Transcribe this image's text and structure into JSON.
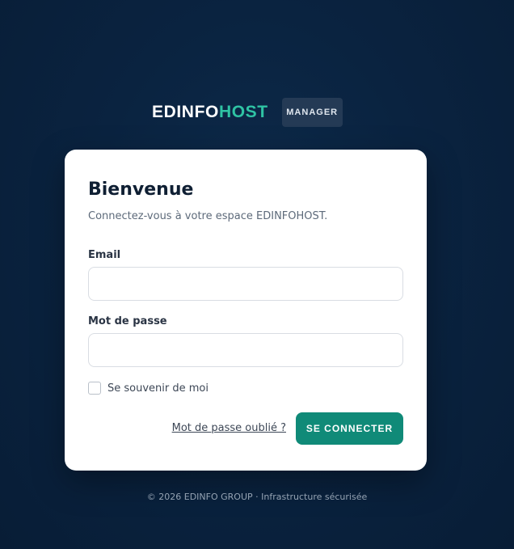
{
  "brand": {
    "name_part1": "EDINFO",
    "name_part2": "HOST",
    "badge": "MANAGER"
  },
  "login_card": {
    "title": "Bienvenue",
    "subtitle": "Connectez-vous à votre espace EDINFOHOST.",
    "email": {
      "label": "Email",
      "value": "",
      "placeholder": ""
    },
    "password": {
      "label": "Mot de passe",
      "value": "",
      "placeholder": ""
    },
    "remember": {
      "label": "Se souvenir de moi",
      "checked": false
    },
    "forgot_link": "Mot de passe oublié ?",
    "submit_label": "SE CONNECTER"
  },
  "footer": "© 2026 EDINFO GROUP · Infrastructure sécurisée",
  "colors": {
    "background": "#0a2340",
    "accent": "#2fc3a4",
    "button": "#108a78",
    "badge_bg": "#243a55"
  }
}
